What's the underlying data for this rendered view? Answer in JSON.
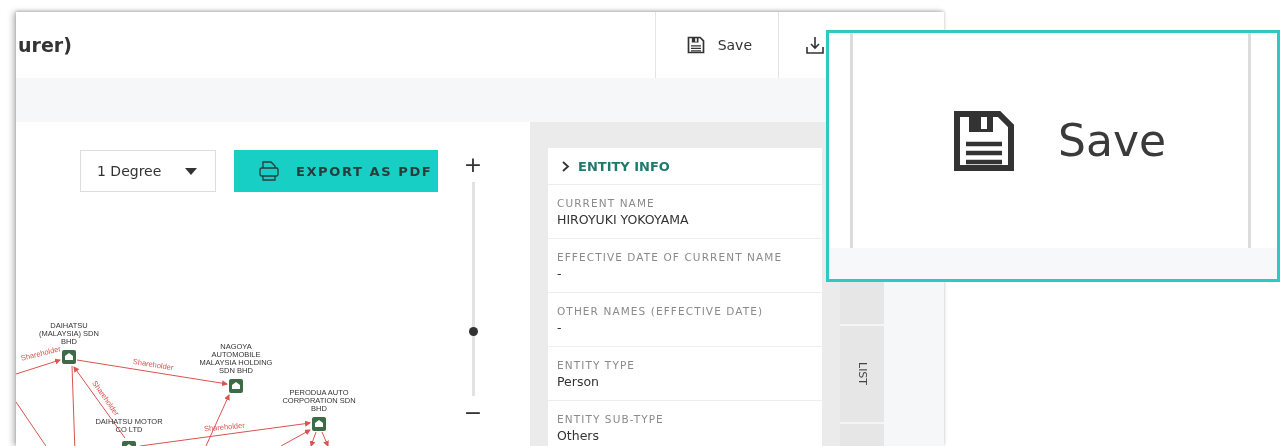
{
  "header": {
    "title": "urer)",
    "buttons": [
      {
        "kind": "save",
        "label": "Save"
      },
      {
        "kind": "download"
      }
    ]
  },
  "graph_toolbar": {
    "degree_select": {
      "value": "1 Degree"
    },
    "export_button": {
      "label": "EXPORT AS PDF"
    }
  },
  "zoom_slider": {
    "plus": "+",
    "minus": "−",
    "level": 0.3
  },
  "graph": {
    "nodes": [
      {
        "label": "DAIHATSU (MALAYSIA) SDN BHD"
      },
      {
        "label": "NAGOYA AUTOMOBILE MALAYSIA HOLDING SDN BHD"
      },
      {
        "label": "PERODUA AUTO CORPORATION SDN BHD"
      },
      {
        "label": "DAIHATSU MOTOR CO LTD"
      }
    ],
    "edges": [
      {
        "label": "Shareholder"
      },
      {
        "label": "Shareholder"
      },
      {
        "label": "Shareholder"
      },
      {
        "label": "Shareholder"
      }
    ]
  },
  "entity_info": {
    "title": "ENTITY INFO",
    "fields": [
      {
        "label": "CURRENT NAME",
        "value": "HIROYUKI YOKOYAMA"
      },
      {
        "label": "EFFECTIVE DATE OF CURRENT NAME",
        "value": "-"
      },
      {
        "label": "OTHER NAMES (EFFECTIVE DATE)",
        "value": "-"
      },
      {
        "label": "ENTITY TYPE",
        "value": "Person"
      },
      {
        "label": "ENTITY SUB-TYPE",
        "value": "Others"
      }
    ]
  },
  "side_tabs": [
    {
      "label": "LIST"
    }
  ],
  "callout": {
    "label": "Save"
  }
}
